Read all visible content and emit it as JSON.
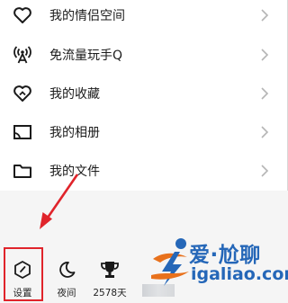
{
  "menu": {
    "items": [
      {
        "label": "我的情侣空间",
        "icon": "heart-icon"
      },
      {
        "label": "免流量玩手Q",
        "icon": "signal-tower-icon"
      },
      {
        "label": "我的收藏",
        "icon": "favorite-heart-icon"
      },
      {
        "label": "我的相册",
        "icon": "photo-album-icon"
      },
      {
        "label": "我的文件",
        "icon": "folder-icon"
      }
    ],
    "chevron": "chevron-right-icon"
  },
  "toolbar": {
    "settings_label": "设置",
    "night_label": "夜间",
    "days_label": "2578天"
  },
  "annotation": {
    "highlight_color": "#e0242b"
  },
  "watermark": {
    "title": "爱·尬聊",
    "url": "igaliao.com",
    "color": "#2567b8"
  }
}
